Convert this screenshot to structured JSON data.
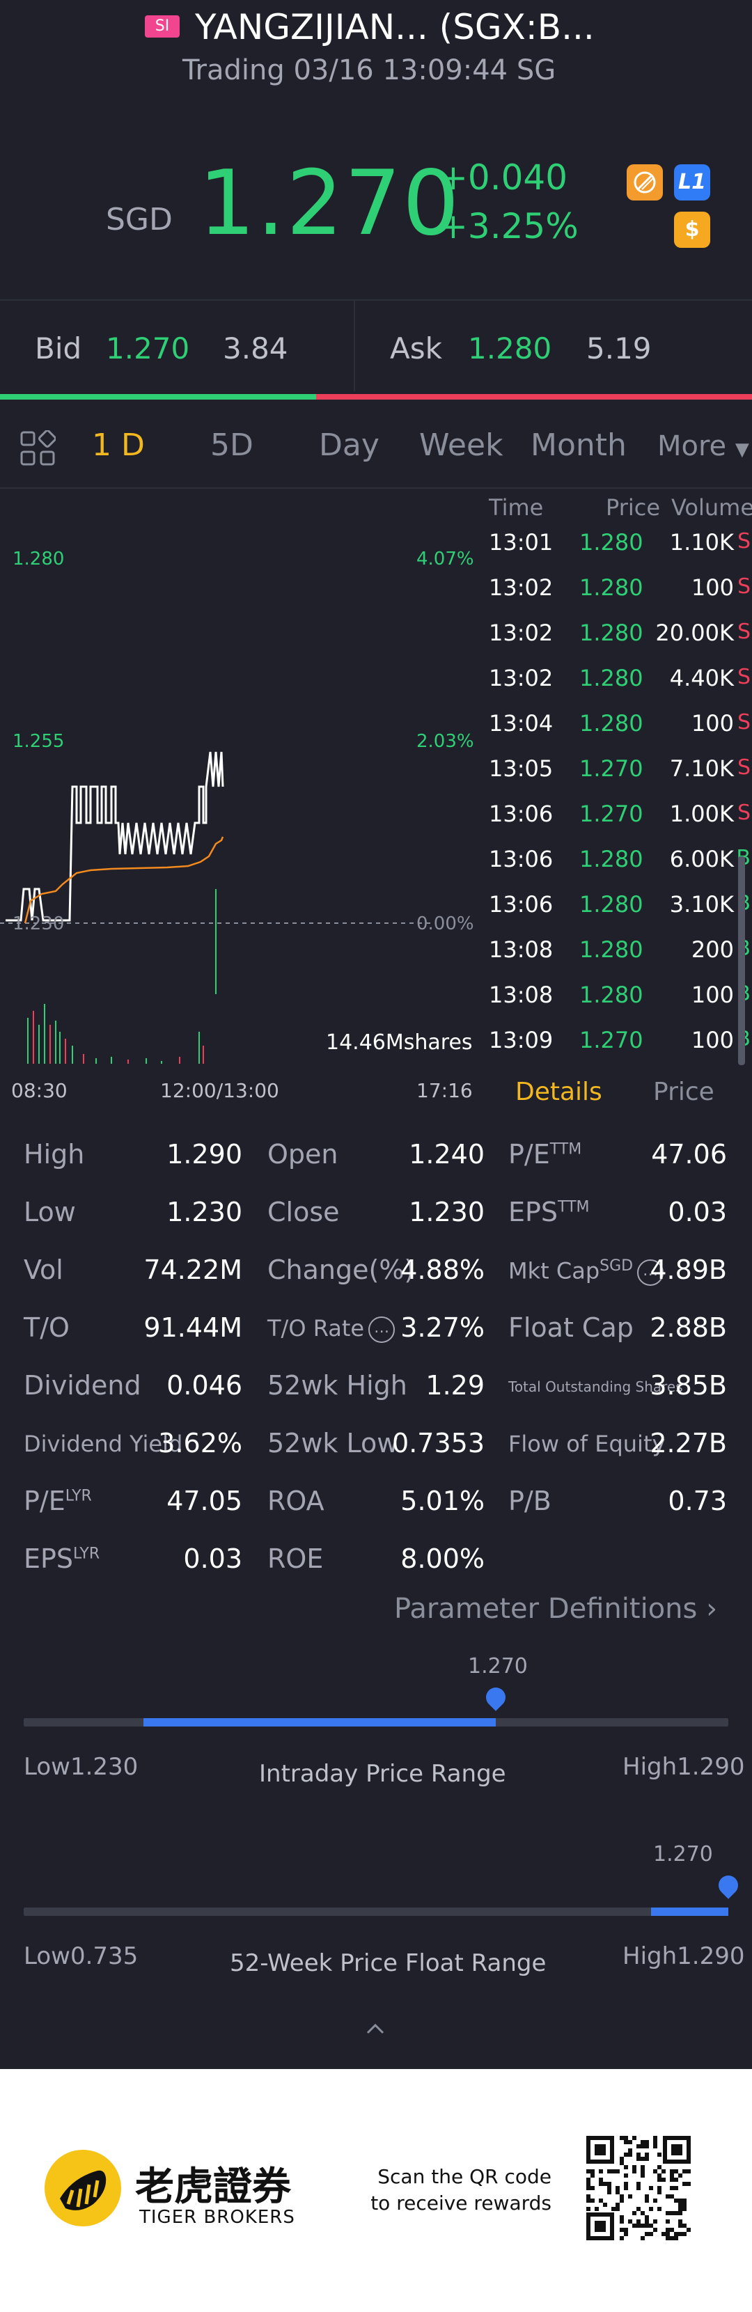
{
  "header": {
    "badge": "SI",
    "title": "YANGZIJIAN... (SGX:B...",
    "subtitle": "Trading 03/16 13:09:44 SG"
  },
  "quote": {
    "currency": "SGD",
    "price": "1.270",
    "change": "+0.040",
    "change_pct": "+3.25%",
    "icons": [
      "no-limit-icon",
      "level1-icon",
      "dollar-icon"
    ],
    "l1_label": "L1",
    "dollar_label": "$"
  },
  "orderbook": {
    "bid_label": "Bid",
    "bid_price": "1.270",
    "bid_volume": "3.84",
    "ask_label": "Ask",
    "ask_price": "1.280",
    "ask_volume": "5.19",
    "bid_ratio": 0.42
  },
  "tabs": [
    "1 D",
    "5D",
    "Day",
    "Week",
    "Month",
    "More"
  ],
  "active_tab": "1 D",
  "chart_labels": {
    "price_high": "1.280",
    "price_mid": "1.255",
    "price_low": "1.230",
    "pct_high": "4.07%",
    "pct_mid": "2.03%",
    "pct_zero": "0.00%",
    "time_start": "08:30",
    "time_mid": "12:00/13:00",
    "time_end": "17:16",
    "volume_label": "14.46Mshares"
  },
  "ticks": {
    "headers": {
      "time": "Time",
      "price": "Price",
      "volume": "Volume"
    },
    "rows": [
      {
        "time": "13:01",
        "price": "1.280",
        "volume": "1.10K",
        "side": "S"
      },
      {
        "time": "13:02",
        "price": "1.280",
        "volume": "100",
        "side": "S"
      },
      {
        "time": "13:02",
        "price": "1.280",
        "volume": "20.00K",
        "side": "S"
      },
      {
        "time": "13:02",
        "price": "1.280",
        "volume": "4.40K",
        "side": "S"
      },
      {
        "time": "13:04",
        "price": "1.280",
        "volume": "100",
        "side": "S"
      },
      {
        "time": "13:05",
        "price": "1.270",
        "volume": "7.10K",
        "side": "S"
      },
      {
        "time": "13:06",
        "price": "1.270",
        "volume": "1.00K",
        "side": "S"
      },
      {
        "time": "13:06",
        "price": "1.280",
        "volume": "6.00K",
        "side": "B"
      },
      {
        "time": "13:06",
        "price": "1.280",
        "volume": "3.10K",
        "side": "B"
      },
      {
        "time": "13:08",
        "price": "1.280",
        "volume": "200",
        "side": "B"
      },
      {
        "time": "13:08",
        "price": "1.280",
        "volume": "100",
        "side": "B"
      },
      {
        "time": "13:09",
        "price": "1.270",
        "volume": "100",
        "side": "B"
      }
    ]
  },
  "detail_tabs": {
    "details": "Details",
    "price": "Price"
  },
  "stats": {
    "col1": [
      {
        "label": "High",
        "value": "1.290"
      },
      {
        "label": "Low",
        "value": "1.230"
      },
      {
        "label": "Vol",
        "value": "74.22M"
      },
      {
        "label": "T/O",
        "value": "91.44M"
      },
      {
        "label": "Dividend",
        "value": "0.046"
      },
      {
        "label": "Dividend Yield",
        "value": "3.62%"
      },
      {
        "label": "P/E",
        "sup": "LYR",
        "value": "47.05"
      },
      {
        "label": "EPS",
        "sup": "LYR",
        "value": "0.03"
      }
    ],
    "col2": [
      {
        "label": "Open",
        "value": "1.240"
      },
      {
        "label": "Close",
        "value": "1.230"
      },
      {
        "label": "Change(%)",
        "value": "4.88%"
      },
      {
        "label": "T/O Rate",
        "value": "3.27%"
      },
      {
        "label": "52wk High",
        "value": "1.29"
      },
      {
        "label": "52wk Low",
        "value": "0.7353"
      },
      {
        "label": "ROA",
        "value": "5.01%"
      },
      {
        "label": "ROE",
        "value": "8.00%"
      }
    ],
    "col3": [
      {
        "label": "P/E",
        "sup": "TTM",
        "value": "47.06"
      },
      {
        "label": "EPS",
        "sup": "TTM",
        "value": "0.03"
      },
      {
        "label": "Mkt Cap",
        "sup": "SGD",
        "value": "4.89B"
      },
      {
        "label": "Float Cap",
        "value": "2.88B"
      },
      {
        "label": "Total Outstanding Shares",
        "value": "3.85B"
      },
      {
        "label": "Flow of Equity",
        "value": "2.27B"
      },
      {
        "label": "P/B",
        "value": "0.73"
      }
    ]
  },
  "param_def": "Parameter Definitions",
  "intraday_range": {
    "title": "Intraday Price Range",
    "low_label": "Low1.230",
    "high_label": "High1.290",
    "current": "1.270",
    "fill_start": 0.17,
    "fill_end": 0.67
  },
  "week52_range": {
    "title": "52-Week Price Float Range",
    "low_label": "Low0.735",
    "high_label": "High1.290",
    "current": "1.270",
    "fill_start": 0.89,
    "fill_end": 1.0
  },
  "footer": {
    "brand_cn": "老虎證券",
    "brand_en": "TIGER BROKERS",
    "scan_line1": "Scan the QR code",
    "scan_line2": "to receive rewards"
  }
}
